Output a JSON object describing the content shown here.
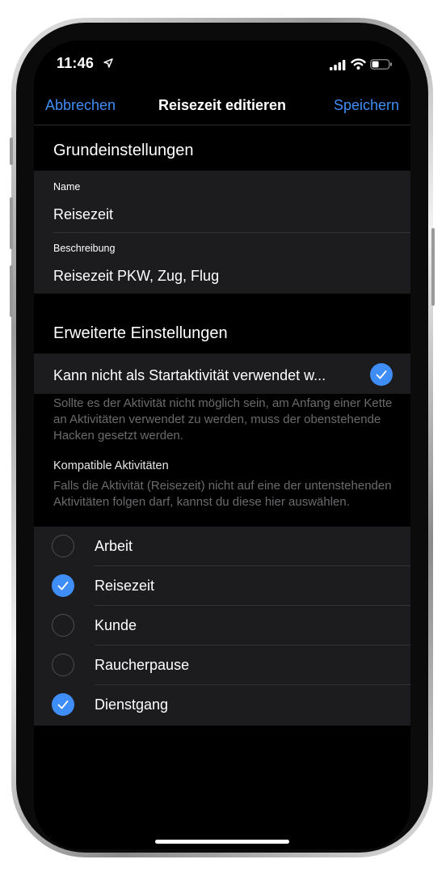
{
  "status_bar": {
    "time": "11:46"
  },
  "nav": {
    "cancel_label": "Abbrechen",
    "title": "Reisezeit editieren",
    "save_label": "Speichern"
  },
  "basic": {
    "header": "Grundeinstellungen",
    "name_label": "Name",
    "name_value": "Reisezeit",
    "desc_label": "Beschreibung",
    "desc_value": "Reisezeit PKW, Zug, Flug"
  },
  "advanced": {
    "header": "Erweiterte Einstellungen",
    "start_option_label": "Kann nicht als Startaktivität verwendet w...",
    "start_option_checked": true,
    "start_option_footer": "Sollte es der Aktivität nicht möglich sein, am Anfang einer Kette an Aktivitäten verwendet zu werden, muss der obenstehende Hacken gesetzt werden.",
    "compatible_header": "Kompatible Aktivitäten",
    "compatible_footer": "Falls die Aktivität (Reisezeit) nicht auf eine der untenstehenden Aktivitäten folgen darf, kannst du diese hier auswählen."
  },
  "activities": [
    {
      "label": "Arbeit",
      "checked": false
    },
    {
      "label": "Reisezeit",
      "checked": true
    },
    {
      "label": "Kunde",
      "checked": false
    },
    {
      "label": "Raucherpause",
      "checked": false
    },
    {
      "label": "Dienstgang",
      "checked": true
    }
  ],
  "colors": {
    "accent": "#3f8df6",
    "background": "#000000",
    "cell": "#1c1c1e",
    "footnote": "#6b6b6e"
  },
  "icons": [
    "location-arrow-icon",
    "signal-icon",
    "wifi-icon",
    "battery-icon",
    "checkmark-icon"
  ]
}
